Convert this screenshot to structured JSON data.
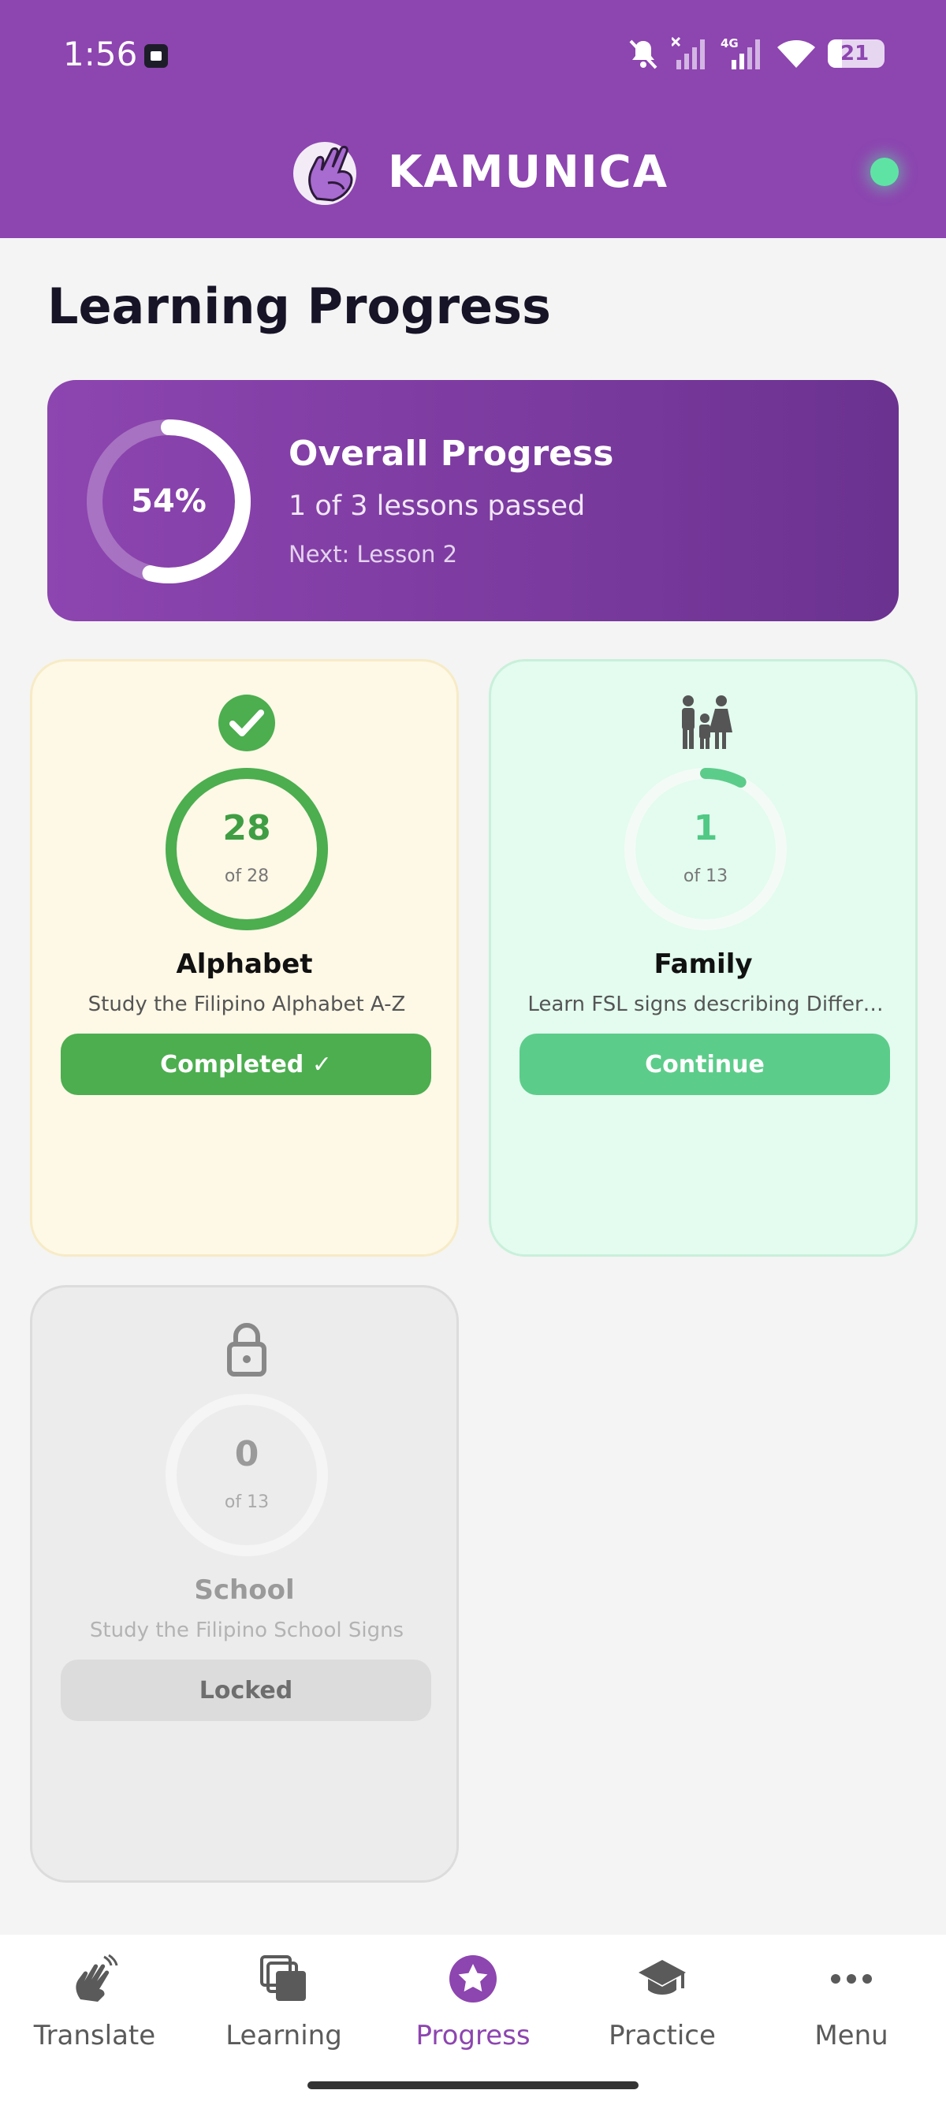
{
  "status_bar": {
    "time": "1:56",
    "battery": "21",
    "network": "4G"
  },
  "app": {
    "name": "KAMUNICA",
    "online_color": "#5fe3a5",
    "accent": "#8d45b0"
  },
  "page": {
    "title": "Learning Progress"
  },
  "overall": {
    "percent_label": "54%",
    "percent_value": 54,
    "title": "Overall Progress",
    "subtitle": "1 of 3 lessons passed",
    "next": "Next: Lesson 2"
  },
  "lessons": [
    {
      "title": "Alphabet",
      "description": "Study the Filipino Alphabet A-Z",
      "count": "28",
      "of_label": "of 28",
      "progress": 1.0,
      "button": "Completed ✓",
      "status": "completed",
      "icon": "check-circle-icon"
    },
    {
      "title": "Family",
      "description": "Learn FSL signs describing Differ…",
      "count": "1",
      "of_label": "of 13",
      "progress": 0.077,
      "button": "Continue",
      "status": "in-progress",
      "icon": "family-icon"
    },
    {
      "title": "School",
      "description": "Study the Filipino School Signs",
      "count": "0",
      "of_label": "of 13",
      "progress": 0,
      "button": "Locked",
      "status": "locked",
      "icon": "lock-icon"
    }
  ],
  "nav": {
    "items": [
      {
        "label": "Translate",
        "icon": "hand-wave-icon"
      },
      {
        "label": "Learning",
        "icon": "cards-icon"
      },
      {
        "label": "Progress",
        "icon": "star-badge-icon",
        "active": true
      },
      {
        "label": "Practice",
        "icon": "graduation-cap-icon"
      },
      {
        "label": "Menu",
        "icon": "more-dots-icon"
      }
    ]
  }
}
